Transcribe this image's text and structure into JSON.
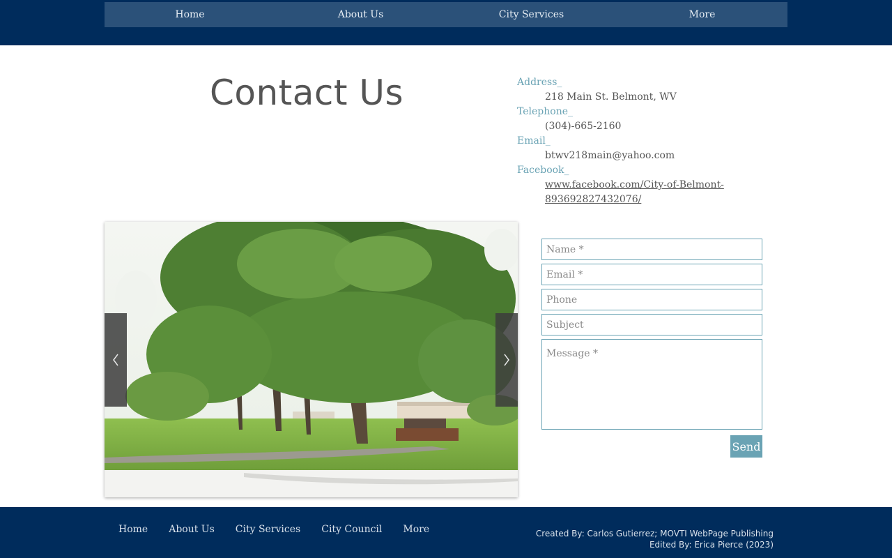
{
  "header": {
    "nav": [
      {
        "label": "Home"
      },
      {
        "label": "About Us"
      },
      {
        "label": "City Services"
      },
      {
        "label": "More"
      }
    ]
  },
  "main": {
    "title": "Contact Us",
    "info": {
      "address_label": "Address_",
      "address": "218 Main St. Belmont, WV",
      "telephone_label": "Telephone_",
      "telephone": "(304)-665-2160",
      "email_label": "Email_",
      "email": "btwv218main@yahoo.com",
      "facebook_label": "Facebook_",
      "facebook_url": "www.facebook.com/City-of-Belmont-893692827432076/"
    },
    "gallery": {
      "prev_icon": "chevron-left-icon",
      "next_icon": "chevron-right-icon"
    },
    "form": {
      "name_placeholder": "Name *",
      "email_placeholder": "Email *",
      "phone_placeholder": "Phone",
      "subject_placeholder": "Subject",
      "message_placeholder": "Message *",
      "send_label": "Send"
    }
  },
  "footer": {
    "nav": [
      {
        "label": "Home"
      },
      {
        "label": "About Us"
      },
      {
        "label": "City Services"
      },
      {
        "label": "City Council"
      },
      {
        "label": "More"
      }
    ],
    "created_by": "Created By: Carlos Gutierrez; MOVTI WebPage Publishing",
    "edited_by": "Edited By: Erica Pierce  (2023)"
  },
  "colors": {
    "header_bg": "#002c5c",
    "nav_bar": "#2b5179",
    "accent": "#6aa3b4",
    "text": "#555555"
  }
}
